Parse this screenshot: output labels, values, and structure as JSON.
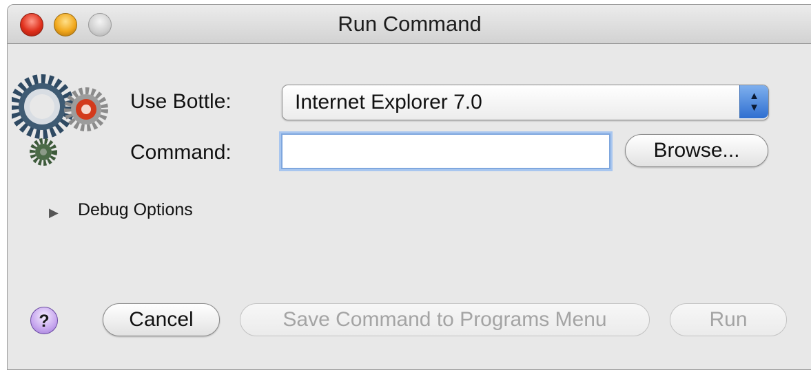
{
  "window": {
    "title": "Run Command",
    "controls": [
      "close",
      "minimize",
      "zoom"
    ]
  },
  "form": {
    "bottle_label": "Use Bottle:",
    "bottle_selected": "Internet Explorer 7.0",
    "command_label": "Command:",
    "command_value": "",
    "browse_label": "Browse..."
  },
  "debug": {
    "label": "Debug Options",
    "expanded": false
  },
  "footer": {
    "help_label": "?",
    "cancel_label": "Cancel",
    "save_label": "Save Command to Programs Menu",
    "run_label": "Run"
  },
  "icons": {
    "app_icon": "gears-icon",
    "select_arrows": "up-down-arrows-icon",
    "disclosure": "triangle-right-icon"
  }
}
